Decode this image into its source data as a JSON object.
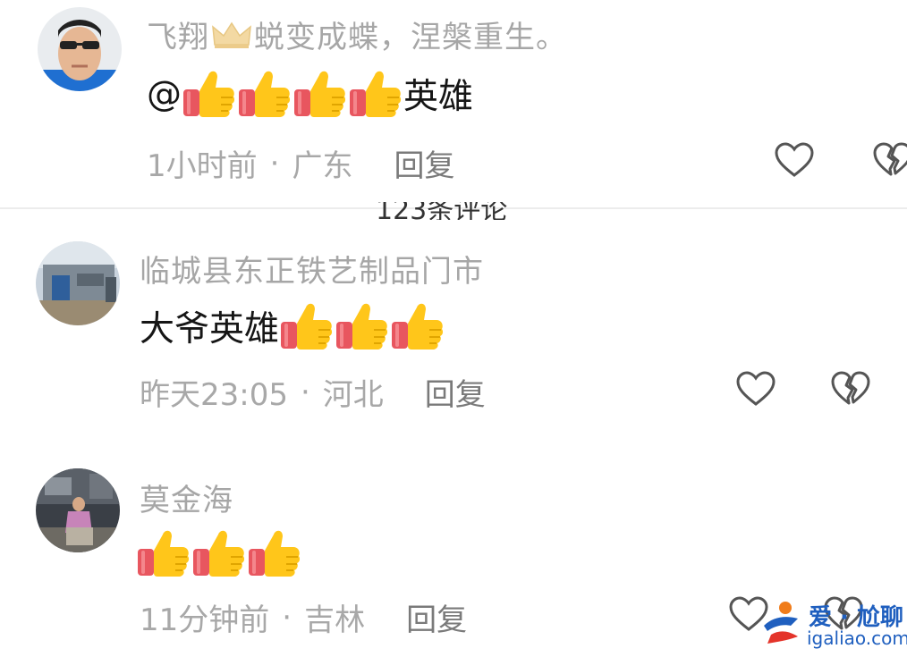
{
  "comments": [
    {
      "username_prefix": "飞翔",
      "username_suffix": "蜕变成蝶，涅槃重生。",
      "content_prefix": "@",
      "content_suffix": "英雄",
      "content_emoji": "thumbs-up",
      "thumb_count": 4,
      "time": "1小时前",
      "location": "广东",
      "reply_label": "回复"
    },
    {
      "username": "临城县东正铁艺制品门市",
      "content_prefix": "大爷英雄",
      "content_emoji": "thumbs-up",
      "thumb_count": 3,
      "time": "昨天23:05",
      "location": "河北",
      "reply_label": "回复"
    },
    {
      "username": "莫金海",
      "content_emoji": "thumbs-up",
      "thumb_count": 3,
      "time": "11分钟前",
      "location": "吉林",
      "reply_label": "回复"
    }
  ],
  "separator": "·",
  "colors": {
    "username": "#a6a6a6",
    "content": "#161616",
    "meta": "#a8a8a8",
    "thumb_yellow": "#ffc61a",
    "thumb_cuff": "#e8565f"
  },
  "watermark": {
    "line1": "爱 · 尬聊",
    "line2": "igaliao.com"
  }
}
